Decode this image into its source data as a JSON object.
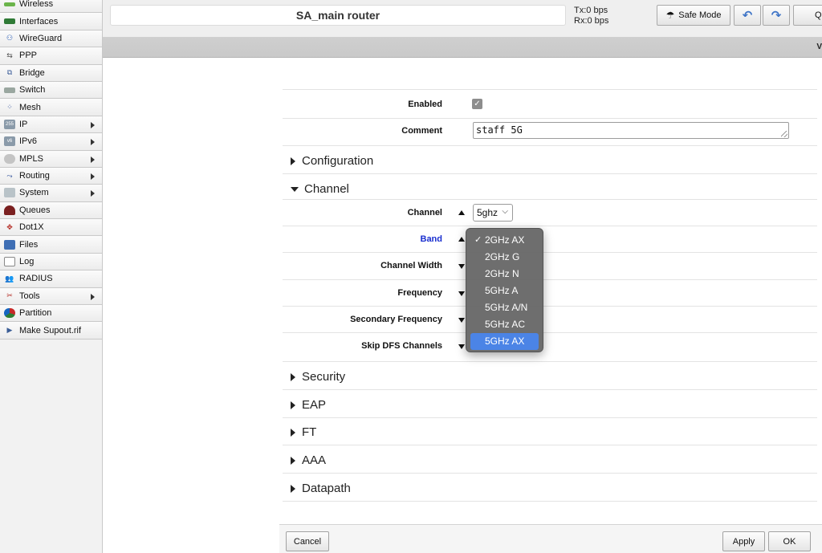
{
  "sidebar": {
    "items": [
      {
        "label": "Wireless",
        "icon": "wireless-icon",
        "submenu": false
      },
      {
        "label": "Interfaces",
        "icon": "interfaces-icon",
        "submenu": false
      },
      {
        "label": "WireGuard",
        "icon": "wireguard-icon",
        "submenu": false
      },
      {
        "label": "PPP",
        "icon": "ppp-icon",
        "submenu": false
      },
      {
        "label": "Bridge",
        "icon": "bridge-icon",
        "submenu": false
      },
      {
        "label": "Switch",
        "icon": "switch-icon",
        "submenu": false
      },
      {
        "label": "Mesh",
        "icon": "mesh-icon",
        "submenu": false
      },
      {
        "label": "IP",
        "icon": "ip-icon",
        "submenu": true
      },
      {
        "label": "IPv6",
        "icon": "ipv6-icon",
        "submenu": true
      },
      {
        "label": "MPLS",
        "icon": "mpls-icon",
        "submenu": true
      },
      {
        "label": "Routing",
        "icon": "routing-icon",
        "submenu": true
      },
      {
        "label": "System",
        "icon": "system-icon",
        "submenu": true
      },
      {
        "label": "Queues",
        "icon": "queues-icon",
        "submenu": false
      },
      {
        "label": "Dot1X",
        "icon": "dot1x-icon",
        "submenu": false
      },
      {
        "label": "Files",
        "icon": "files-icon",
        "submenu": false
      },
      {
        "label": "Log",
        "icon": "log-icon",
        "submenu": false
      },
      {
        "label": "RADIUS",
        "icon": "radius-icon",
        "submenu": false
      },
      {
        "label": "Tools",
        "icon": "tools-icon",
        "submenu": true
      },
      {
        "label": "Partition",
        "icon": "partition-icon",
        "submenu": false
      },
      {
        "label": "Make Supout.rif",
        "icon": "supout-icon",
        "submenu": false
      }
    ]
  },
  "header": {
    "router_name": "SA_main router",
    "tx": "Tx:0 bps",
    "rx": "Rx:0 bps",
    "safe_mode_label": "Safe Mode",
    "quick_label": "Qu",
    "wedge_text": "V"
  },
  "form": {
    "enabled": {
      "label": "Enabled",
      "checked": true
    },
    "comment": {
      "label": "Comment",
      "value": "staff 5G"
    },
    "sections": {
      "configuration": "Configuration",
      "channel": "Channel",
      "security": "Security",
      "eap": "EAP",
      "ft": "FT",
      "aaa": "AAA",
      "datapath": "Datapath"
    },
    "channel_fields": {
      "channel": {
        "label": "Channel",
        "value": "5ghz"
      },
      "band": {
        "label": "Band"
      },
      "channel_width": {
        "label": "Channel Width"
      },
      "frequency": {
        "label": "Frequency"
      },
      "secondary_frequency": {
        "label": "Secondary Frequency"
      },
      "skip_dfs": {
        "label": "Skip DFS Channels"
      }
    }
  },
  "band_dropdown": {
    "options": [
      "2GHz AX",
      "2GHz G",
      "2GHz N",
      "5GHz A",
      "5GHz A/N",
      "5GHz AC",
      "5GHz AX"
    ],
    "checked": "2GHz AX",
    "highlighted": "5GHz AX"
  },
  "footer": {
    "cancel_label": "Cancel",
    "apply_label": "Apply",
    "ok_label": "OK"
  },
  "colors": {
    "highlight": "#4b84e6",
    "band_label": "#1a2fcf"
  }
}
